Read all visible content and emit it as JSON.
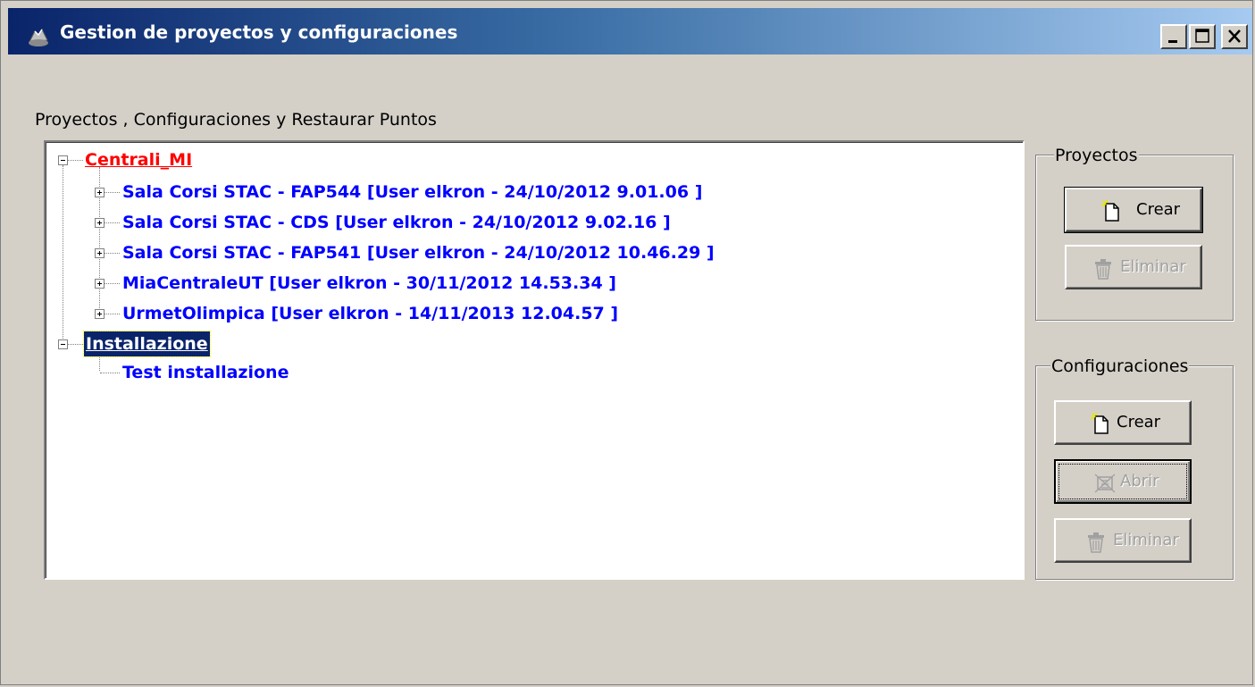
{
  "window": {
    "title": "Gestion de proyectos y configuraciones",
    "controls": [
      "minimize-icon",
      "maximize-icon",
      "close-icon"
    ]
  },
  "tree_caption": "Proyectos , Configuraciones y Restaurar Puntos",
  "tree": {
    "nodes": [
      {
        "label": "Centrali_MI",
        "level": 0,
        "expanded": true,
        "color": "#ff0000"
      },
      {
        "label": "Sala Corsi STAC - FAP544 [User elkron - 24/10/2012 9.01.06 ]",
        "level": 1,
        "expanded": false,
        "color": "#0000ff"
      },
      {
        "label": "Sala Corsi STAC - CDS [User elkron - 24/10/2012 9.02.16 ]",
        "level": 1,
        "expanded": false,
        "color": "#0000ff"
      },
      {
        "label": "Sala Corsi STAC - FAP541 [User elkron - 24/10/2012 10.46.29 ]",
        "level": 1,
        "expanded": false,
        "color": "#0000ff"
      },
      {
        "label": "MiaCentraleUT [User elkron - 30/11/2012 14.53.34 ]",
        "level": 1,
        "expanded": false,
        "color": "#0000ff"
      },
      {
        "label": "UrmetOlimpica [User elkron - 14/11/2013 12.04.57 ]",
        "level": 1,
        "expanded": false,
        "color": "#0000ff"
      },
      {
        "label": "Installazione",
        "level": 0,
        "expanded": true,
        "selected": true,
        "color": "#0000ff"
      },
      {
        "label": "Test installazione",
        "level": 1,
        "leaf": true,
        "color": "#0000ff"
      }
    ]
  },
  "proyectos": {
    "legend": "Proyectos",
    "crear": {
      "label": "Crear",
      "icon": "new-document-icon",
      "enabled": true
    },
    "eliminar": {
      "label": "Eliminar",
      "icon": "trash-icon",
      "enabled": false
    }
  },
  "configuraciones": {
    "legend": "Configuraciones",
    "crear": {
      "label": "Crear",
      "icon": "new-document-icon",
      "enabled": true
    },
    "abrir": {
      "label": "Abrir",
      "icon": "open-config-icon",
      "enabled": false
    },
    "eliminar": {
      "label": "Eliminar",
      "icon": "trash-icon",
      "enabled": false
    }
  },
  "colors": {
    "titlebar_start": "#0a246a",
    "titlebar_end": "#a6caf0",
    "window_bg": "#d4d0c8",
    "root_red": "#ff0000",
    "node_blue": "#0000ff",
    "selection_bg": "#0a246a"
  }
}
